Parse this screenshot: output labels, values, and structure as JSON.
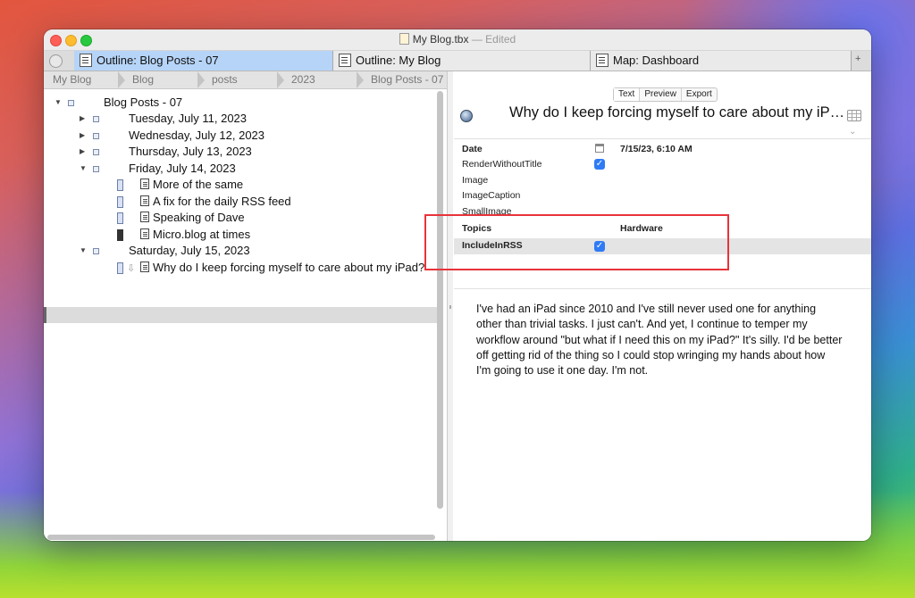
{
  "window": {
    "title": "My Blog.tbx",
    "separator": "—",
    "edited": "Edited"
  },
  "tabs": [
    {
      "label": "Outline: Blog Posts - 07",
      "active": true
    },
    {
      "label": "Outline: My Blog",
      "active": false
    },
    {
      "label": "Map: Dashboard",
      "active": false
    }
  ],
  "tab_add": "+",
  "breadcrumbs": [
    "My Blog",
    "Blog",
    "posts",
    "2023",
    "Blog Posts - 07"
  ],
  "outline": {
    "root": "Blog Posts - 07",
    "days": [
      {
        "label": "Tuesday, July 11, 2023",
        "expanded": false
      },
      {
        "label": "Wednesday, July 12, 2023",
        "expanded": false
      },
      {
        "label": "Thursday, July 13, 2023",
        "expanded": false
      },
      {
        "label": "Friday, July 14, 2023",
        "expanded": true
      },
      {
        "label": "Saturday, July 15, 2023",
        "expanded": true
      }
    ],
    "friday_notes": [
      "More of the same",
      "A fix for the daily RSS feed",
      "Speaking of Dave",
      "Micro.blog at times"
    ],
    "saturday_notes": [
      "Why do I keep forcing myself to care about my iPad?"
    ]
  },
  "view_modes": [
    "Text",
    "Preview",
    "Export"
  ],
  "note": {
    "title": "Why do I keep forcing myself to care about my iP…",
    "attributes": {
      "date_key": "Date",
      "date_value": "7/15/23, 6:10 AM",
      "render_key": "RenderWithoutTitle",
      "render_checked": true,
      "image_key": "Image",
      "caption_key": "ImageCaption",
      "small_image_key": "SmallImage",
      "topics_key": "Topics",
      "topics_value": "Hardware",
      "rss_key": "IncludeInRSS",
      "rss_checked": true
    },
    "body": "I've had an iPad since 2010 and I've still never used one for anything other than trivial tasks. I just can't. And yet, I continue to temper my workflow around \"but what if I need this on my iPad?\" It's silly. I'd be better off getting rid of the thing so I could stop wringing my hands about how I'm going to use it one day. I'm not."
  },
  "icons": {
    "checkbox_mark": "✓",
    "collapsed": "▶",
    "expanded": "▼",
    "chevron": "⌄",
    "arrow": "⇩"
  }
}
